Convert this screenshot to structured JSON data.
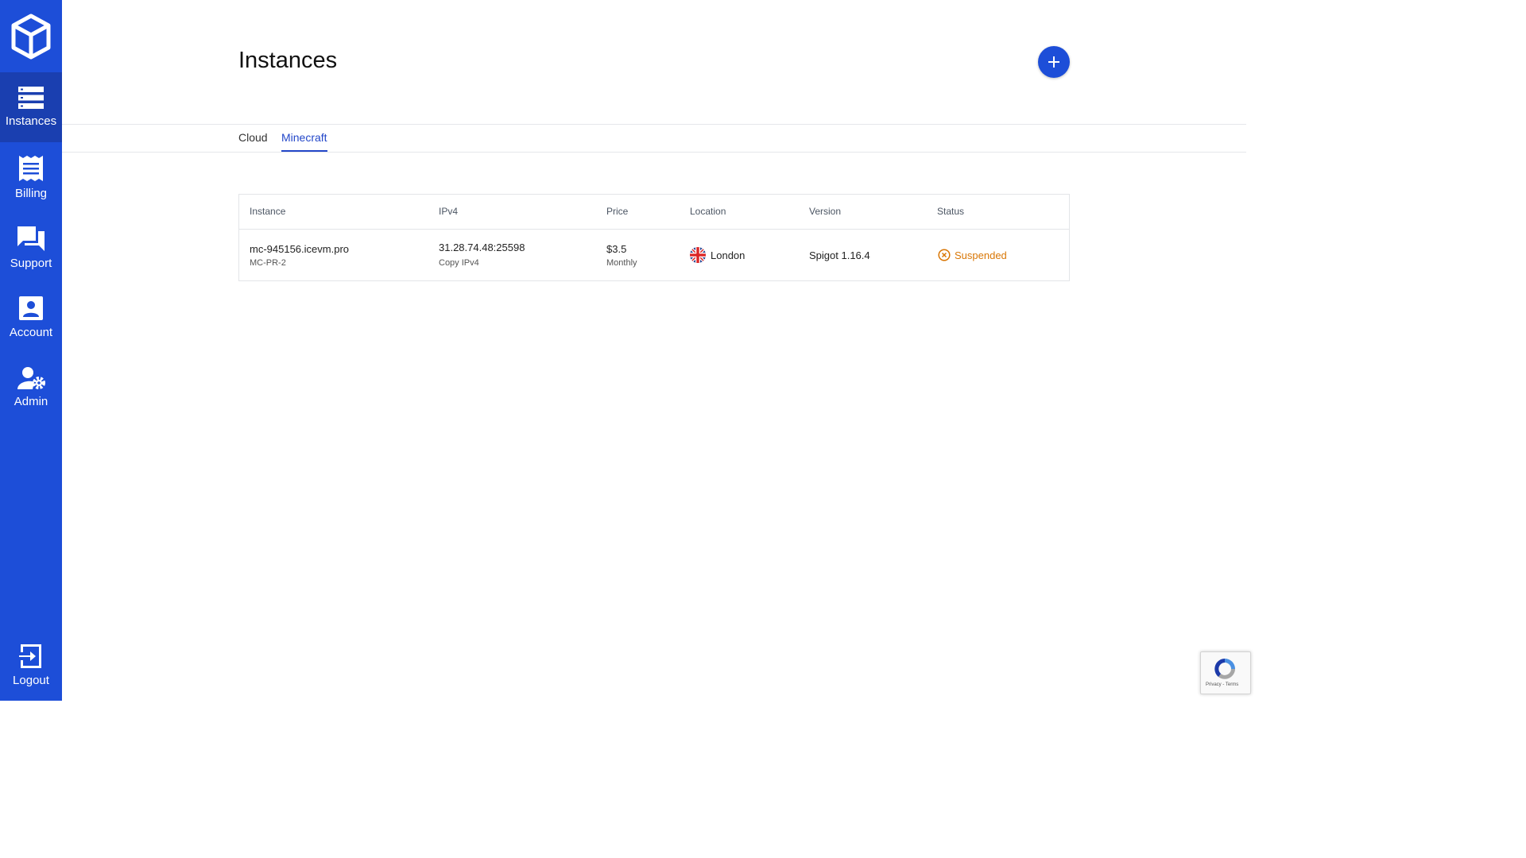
{
  "sidebar": {
    "logo_icon": "cube-icon",
    "items": [
      {
        "label": "Instances",
        "icon": "server-list-icon",
        "active": true
      },
      {
        "label": "Billing",
        "icon": "receipt-icon",
        "active": false
      },
      {
        "label": "Support",
        "icon": "chat-bubbles-icon",
        "active": false
      },
      {
        "label": "Account",
        "icon": "account-box-icon",
        "active": false
      },
      {
        "label": "Admin",
        "icon": "user-gear-icon",
        "active": false
      }
    ],
    "logout": {
      "label": "Logout",
      "icon": "logout-icon"
    }
  },
  "header": {
    "title": "Instances",
    "add_button_icon": "plus-icon"
  },
  "tabs": [
    {
      "label": "Cloud",
      "active": false
    },
    {
      "label": "Minecraft",
      "active": true
    }
  ],
  "table": {
    "headers": [
      "Instance",
      "IPv4",
      "Price",
      "Location",
      "Version",
      "Status"
    ],
    "rows": [
      {
        "instance": "mc-945156.icevm.pro",
        "plan": "MC-PR-2",
        "ipv4": "31.28.74.48:25598",
        "copy_label": "Copy IPv4",
        "price": "$3.5",
        "period": "Monthly",
        "location": "London",
        "location_icon": "uk-flag-icon",
        "version": "Spigot 1.16.4",
        "status": "Suspended",
        "status_icon": "suspended-circle-x-icon"
      }
    ]
  },
  "recaptcha": {
    "text": "Privacy - Terms"
  },
  "colors": {
    "brand": "#1d4ed8",
    "active_tab": "#2347c9",
    "status_suspended": "#d97706"
  }
}
